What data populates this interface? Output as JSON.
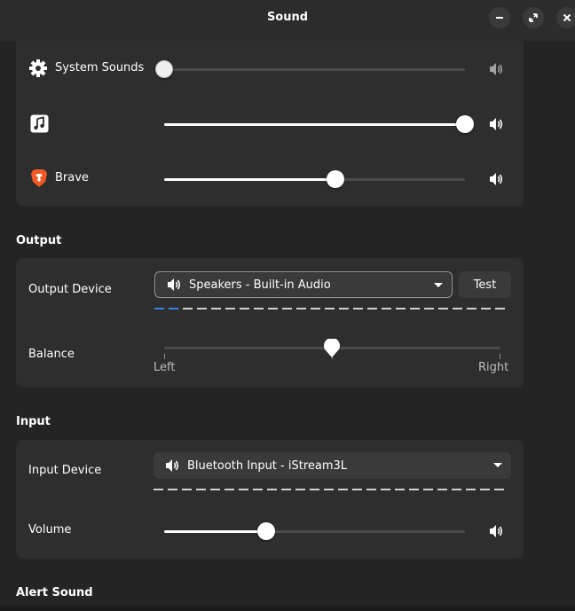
{
  "window": {
    "title": "Sound",
    "minimize_icon": "minimize-icon",
    "maximize_icon": "maximize-icon",
    "close_icon": "close-icon"
  },
  "apps": [
    {
      "name": "System Sounds",
      "icon": "gear-icon",
      "volume": 0.0,
      "muted_icon": "speaker-dim-icon"
    },
    {
      "name": "",
      "icon": "music-note-icon",
      "volume": 1.0,
      "muted_icon": "speaker-icon"
    },
    {
      "name": "Brave",
      "icon": "brave-lion-icon",
      "volume": 0.57,
      "muted_icon": "speaker-icon"
    }
  ],
  "output": {
    "section_title": "Output",
    "device_label": "Output Device",
    "device_value": "Speakers - Built-in Audio",
    "test_label": "Test",
    "level_segments_total": 25,
    "level_segments_on": 2,
    "balance_label": "Balance",
    "balance_left": "Left",
    "balance_right": "Right",
    "balance_value": 0.5
  },
  "input": {
    "section_title": "Input",
    "device_label": "Input Device",
    "device_value": "Bluetooth Input - iStream3L",
    "level_segments_total": 25,
    "level_segments_on": 0,
    "volume_label": "Volume",
    "volume_value": 0.34
  },
  "alert": {
    "section_title": "Alert Sound"
  },
  "colors": {
    "accent": "#3584e4",
    "card": "#2e2e2e",
    "window": "#242424",
    "headerbar": "#2c2c2c"
  }
}
